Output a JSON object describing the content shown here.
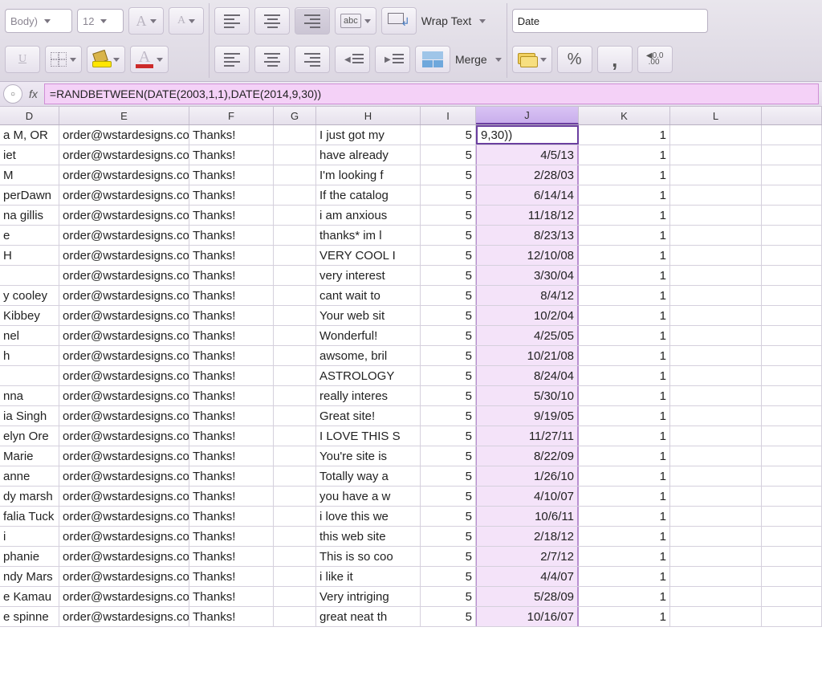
{
  "ribbon": {
    "font_name": "Body)",
    "font_size": "12",
    "namebox": "Date",
    "wrap_label": "Wrap Text",
    "merge_label": "Merge",
    "abc_label": "abc",
    "percent_label": "%",
    "comma_label": ",",
    "inc_dec_a": "0.0",
    "inc_dec_b": ".00"
  },
  "formula": {
    "fx": "fx",
    "value": "=RANDBETWEEN(DATE(2003,1,1),DATE(2014,9,30))"
  },
  "columns": [
    "D",
    "E",
    "F",
    "G",
    "H",
    "I",
    "J",
    "K",
    "L"
  ],
  "selected_column": "J",
  "rows": [
    {
      "D": "a M, OR",
      "E": "order@wstardesigns.com",
      "F": "Thanks!",
      "G": "",
      "H": "I just got my",
      "I": "5",
      "J": "9,30))",
      "K": "1"
    },
    {
      "D": "iet",
      "E": "order@wstardesigns.com",
      "F": "Thanks!",
      "G": "",
      "H": "have already",
      "I": "5",
      "J": "4/5/13",
      "K": "1"
    },
    {
      "D": "M",
      "E": "order@wstardesigns.com",
      "F": "Thanks!",
      "G": "",
      "H": "I'm looking f",
      "I": "5",
      "J": "2/28/03",
      "K": "1"
    },
    {
      "D": "perDawn",
      "E": "order@wstardesigns.com",
      "F": "Thanks!",
      "G": "",
      "H": "If the catalog",
      "I": "5",
      "J": "6/14/14",
      "K": "1"
    },
    {
      "D": "na gillis",
      "E": "order@wstardesigns.com",
      "F": "Thanks!",
      "G": "",
      "H": "i am anxious",
      "I": "5",
      "J": "11/18/12",
      "K": "1"
    },
    {
      "D": "e",
      "E": "order@wstardesigns.com",
      "F": "Thanks!",
      "G": "",
      "H": "thanks* im l",
      "I": "5",
      "J": "8/23/13",
      "K": "1"
    },
    {
      "D": "H",
      "E": "order@wstardesigns.com",
      "F": "Thanks!",
      "G": "",
      "H": "VERY COOL I",
      "I": "5",
      "J": "12/10/08",
      "K": "1"
    },
    {
      "D": "",
      "E": "order@wstardesigns.com",
      "F": "Thanks!",
      "G": "",
      "H": "very interest",
      "I": "5",
      "J": "3/30/04",
      "K": "1"
    },
    {
      "D": "y cooley",
      "E": "order@wstardesigns.com",
      "F": "Thanks!",
      "G": "",
      "H": "cant wait to",
      "I": "5",
      "J": "8/4/12",
      "K": "1"
    },
    {
      "D": "Kibbey",
      "E": "order@wstardesigns.com",
      "F": "Thanks!",
      "G": "",
      "H": "Your web sit",
      "I": "5",
      "J": "10/2/04",
      "K": "1"
    },
    {
      "D": "nel",
      "E": "order@wstardesigns.com",
      "F": "Thanks!",
      "G": "",
      "H": "Wonderful!",
      "I": "5",
      "J": "4/25/05",
      "K": "1"
    },
    {
      "D": "h",
      "E": "order@wstardesigns.com",
      "F": "Thanks!",
      "G": "",
      "H": "awsome, bril",
      "I": "5",
      "J": "10/21/08",
      "K": "1"
    },
    {
      "D": "",
      "E": "order@wstardesigns.com",
      "F": "Thanks!",
      "G": "",
      "H": "ASTROLOGY",
      "I": "5",
      "J": "8/24/04",
      "K": "1"
    },
    {
      "D": "nna",
      "E": "order@wstardesigns.com",
      "F": "Thanks!",
      "G": "",
      "H": "really interes",
      "I": "5",
      "J": "5/30/10",
      "K": "1"
    },
    {
      "D": "ia Singh",
      "E": "order@wstardesigns.com",
      "F": "Thanks!",
      "G": "",
      "H": "Great site!",
      "I": "5",
      "J": "9/19/05",
      "K": "1"
    },
    {
      "D": "elyn Ore",
      "E": "order@wstardesigns.com",
      "F": "Thanks!",
      "G": "",
      "H": "I LOVE THIS S",
      "I": "5",
      "J": "11/27/11",
      "K": "1"
    },
    {
      "D": "Marie",
      "E": "order@wstardesigns.com",
      "F": "Thanks!",
      "G": "",
      "H": " You're site is",
      "I": "5",
      "J": "8/22/09",
      "K": "1"
    },
    {
      "D": "anne",
      "E": "order@wstardesigns.com",
      "F": "Thanks!",
      "G": "",
      "H": "Totally way a",
      "I": "5",
      "J": "1/26/10",
      "K": "1"
    },
    {
      "D": "dy marsh",
      "E": "order@wstardesigns.com",
      "F": "Thanks!",
      "G": "",
      "H": "you have a w",
      "I": "5",
      "J": "4/10/07",
      "K": "1"
    },
    {
      "D": "falia Tuck",
      "E": "order@wstardesigns.com",
      "F": "Thanks!",
      "G": "",
      "H": "i love this we",
      "I": "5",
      "J": "10/6/11",
      "K": "1"
    },
    {
      "D": "i",
      "E": "order@wstardesigns.com",
      "F": "Thanks!",
      "G": "",
      "H": "this web site",
      "I": "5",
      "J": "2/18/12",
      "K": "1"
    },
    {
      "D": "phanie",
      "E": "order@wstardesigns.com",
      "F": "Thanks!",
      "G": "",
      "H": "This is so coo",
      "I": "5",
      "J": "2/7/12",
      "K": "1"
    },
    {
      "D": "ndy Mars",
      "E": "order@wstardesigns.com",
      "F": "Thanks!",
      "G": "",
      "H": "i like it",
      "I": "5",
      "J": "4/4/07",
      "K": "1"
    },
    {
      "D": "e Kamau",
      "E": "order@wstardesigns.com",
      "F": "Thanks!",
      "G": "",
      "H": "Very intriging",
      "I": "5",
      "J": "5/28/09",
      "K": "1"
    },
    {
      "D": "e spinne",
      "E": "order@wstardesigns.com",
      "F": "Thanks!",
      "G": "",
      "H": "great neat th",
      "I": "5",
      "J": "10/16/07",
      "K": "1"
    }
  ]
}
